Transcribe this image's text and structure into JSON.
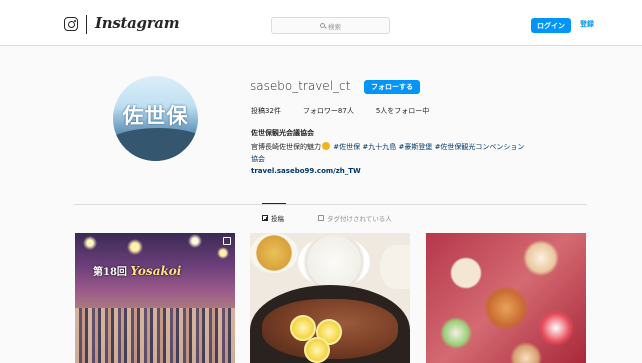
{
  "header": {
    "logo_text": "Instagram",
    "search_placeholder": "検索",
    "login_label": "ログイン",
    "signup_label": "登録"
  },
  "profile": {
    "avatar_text": "佐世保",
    "username": "sasebo_travel_ct",
    "follow_label": "フォローする",
    "stats": {
      "posts": "投稿32件",
      "followers": "フォロワー87人",
      "following": "5人をフォロー中"
    },
    "full_name": "佐世保観光会議協会",
    "bio_prefix": "官博長崎佐世保的魅力",
    "bio_tags": [
      "#佐世保",
      "#九十九島",
      "#豪斯登堡",
      "#佐世保観光コンベンション"
    ],
    "bio_suffix": "協会",
    "website": "travel.sasebo99.com/zh_TW"
  },
  "tabs": {
    "posts_label": "投稿",
    "tagged_label": "タグ付けされている人"
  },
  "posts": [
    {
      "overlay_text": "第18回",
      "overlay_title": "Yosakoi"
    },
    {
      "overlay_text": ""
    },
    {
      "overlay_text": ""
    }
  ],
  "colors": {
    "accent": "#0095f6",
    "link": "#00376b",
    "text": "#262626",
    "muted": "#8e8e8e",
    "background": "#fafafa"
  }
}
